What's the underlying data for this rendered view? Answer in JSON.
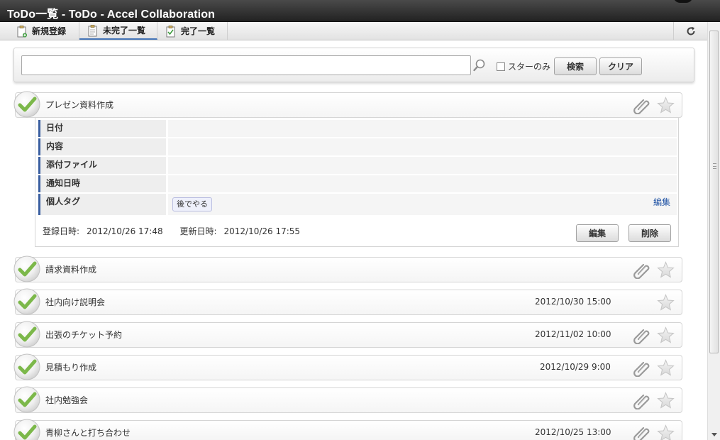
{
  "window": {
    "title": "ToDo一覧 - ToDo - Accel Collaboration"
  },
  "tabs": [
    {
      "label": "新規登録",
      "icon": "clipboard-plus-icon",
      "active": false
    },
    {
      "label": "未完了一覧",
      "icon": "clipboard-icon",
      "active": true
    },
    {
      "label": "完了一覧",
      "icon": "clipboard-check-icon",
      "active": false
    }
  ],
  "search": {
    "value": "",
    "placeholder": "",
    "star_only_label": "スターのみ",
    "star_only_checked": false,
    "search_label": "検索",
    "clear_label": "クリア"
  },
  "detail": {
    "fields": [
      {
        "label": "日付",
        "value": ""
      },
      {
        "label": "内容",
        "value": ""
      },
      {
        "label": "添付ファイル",
        "value": ""
      },
      {
        "label": "通知日時",
        "value": ""
      },
      {
        "label": "個人タグ",
        "value": ""
      }
    ],
    "tag": "後でやる",
    "tag_edit_label": "編集",
    "created_label": "登録日時:",
    "created_value": "2012/10/26 17:48",
    "updated_label": "更新日時:",
    "updated_value": "2012/10/26 17:55",
    "edit_label": "編集",
    "delete_label": "削除"
  },
  "todos": [
    {
      "title": "プレゼン資料作成",
      "date": "",
      "has_attachment": true,
      "starred": false,
      "expanded": true
    },
    {
      "title": "請求資料作成",
      "date": "",
      "has_attachment": true,
      "starred": false
    },
    {
      "title": "社内向け説明会",
      "date": "2012/10/30 15:00",
      "has_attachment": false,
      "starred": false
    },
    {
      "title": "出張のチケット予約",
      "date": "2012/11/02 10:00",
      "has_attachment": true,
      "starred": false
    },
    {
      "title": "見積もり作成",
      "date": "2012/10/29 9:00",
      "has_attachment": true,
      "starred": false
    },
    {
      "title": "社内勉強会",
      "date": "",
      "has_attachment": true,
      "starred": false
    },
    {
      "title": "青柳さんと打ち合わせ",
      "date": "2012/10/25 13:00",
      "has_attachment": true,
      "starred": false
    }
  ],
  "colors": {
    "accent": "#4676b8",
    "check_green": "#7cb84a",
    "label_bar": "#3a5fa0",
    "link": "#2456a6"
  }
}
